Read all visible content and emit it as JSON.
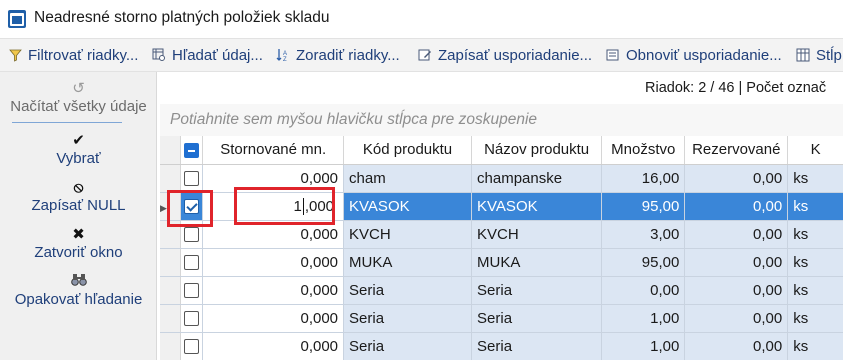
{
  "window": {
    "title": "Neadresné storno platných položiek skladu",
    "icon": "app-logo-icon"
  },
  "toolbar": {
    "items": [
      {
        "label": "Filtrovať riadky...",
        "icon": "filter-icon"
      },
      {
        "label": "Hľadať údaj...",
        "icon": "find-data-icon"
      },
      {
        "label": "Zoradiť riadky...",
        "icon": "sort-icon"
      },
      {
        "label": "Zapísať usporiadanie...",
        "icon": "save-layout-icon"
      },
      {
        "label": "Obnoviť usporiadanie...",
        "icon": "restore-layout-icon"
      },
      {
        "label": "Stĺp",
        "icon": "columns-icon"
      }
    ]
  },
  "sidebar": {
    "items": [
      {
        "label": "Načítať všetky údaje",
        "icon": "refresh-icon",
        "enabled": false
      },
      {
        "label": "Vybrať",
        "icon": "checkmark-icon",
        "enabled": true
      },
      {
        "label": "Zapísať NULL",
        "icon": "null-icon",
        "enabled": true
      },
      {
        "label": "Zatvoriť okno",
        "icon": "close-icon",
        "enabled": true
      },
      {
        "label": "Opakovať hľadanie",
        "icon": "binoculars-icon",
        "enabled": true
      }
    ]
  },
  "status": {
    "row_info": "Riadok: 2 / 46 | Počet označ"
  },
  "grouping": {
    "placeholder": "Potiahnite sem myšou hlavičku stĺpca pre zoskupenie"
  },
  "grid": {
    "columns": [
      "Stornované mn.",
      "Kód produktu",
      "Názov produktu",
      "Množstvo",
      "Rezervované",
      "K"
    ],
    "rows": [
      {
        "checked": false,
        "storno": "0,000",
        "kod": "cham",
        "nazov": "champanske",
        "mnozstvo": "16,00",
        "rezervovane": "0,00",
        "jed": "ks"
      },
      {
        "checked": true,
        "selected": true,
        "storno_before_caret": "1",
        "storno_after_caret": ",000",
        "kod": "KVASOK",
        "nazov": "KVASOK",
        "mnozstvo": "95,00",
        "rezervovane": "0,00",
        "jed": "ks"
      },
      {
        "checked": false,
        "storno": "0,000",
        "kod": "KVCH",
        "nazov": "KVCH",
        "mnozstvo": "3,00",
        "rezervovane": "0,00",
        "jed": "ks"
      },
      {
        "checked": false,
        "storno": "0,000",
        "kod": "MUKA",
        "nazov": "MUKA",
        "mnozstvo": "95,00",
        "rezervovane": "0,00",
        "jed": "ks"
      },
      {
        "checked": false,
        "storno": "0,000",
        "kod": "Seria",
        "nazov": "Seria",
        "mnozstvo": "0,00",
        "rezervovane": "0,00",
        "jed": "ks"
      },
      {
        "checked": false,
        "storno": "0,000",
        "kod": "Seria",
        "nazov": "Seria",
        "mnozstvo": "1,00",
        "rezervovane": "0,00",
        "jed": "ks"
      },
      {
        "checked": false,
        "storno": "0,000",
        "kod": "Seria",
        "nazov": "Seria",
        "mnozstvo": "1,00",
        "rezervovane": "0,00",
        "jed": "ks"
      }
    ]
  },
  "colors": {
    "selection": "#3a86d8",
    "row_band": "#dce6f3",
    "highlight": "#e0242b",
    "link_text": "#1f3f7a"
  }
}
